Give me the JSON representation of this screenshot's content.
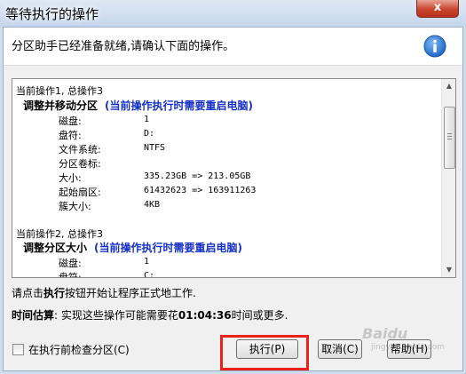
{
  "window": {
    "title": "等待执行的操作",
    "close_label": "x"
  },
  "header": {
    "message": "分区助手已经准备就绪,请确认下面的操作。",
    "icon": "info-icon"
  },
  "operations": [
    {
      "header": "当前操作1, 总操作3",
      "title": "调整并移动分区",
      "note": "(当前操作执行时需要重启电脑)",
      "properties": [
        {
          "label": "磁盘:",
          "value": "1"
        },
        {
          "label": "盘符:",
          "value": "D:"
        },
        {
          "label": "文件系统:",
          "value": "NTFS"
        },
        {
          "label": "分区卷标:",
          "value": ""
        },
        {
          "label": "大小:",
          "value": "335.23GB => 213.05GB"
        },
        {
          "label": "起始扇区:",
          "value": "61432623 => 163911263"
        },
        {
          "label": "簇大小:",
          "value": "4KB"
        }
      ]
    },
    {
      "header": "当前操作2, 总操作3",
      "title": "调整分区大小",
      "note": "(当前操作执行时需要重启电脑)",
      "properties": [
        {
          "label": "磁盘:",
          "value": "1"
        },
        {
          "label": "盘符:",
          "value": "C:"
        }
      ]
    }
  ],
  "hint": {
    "prefix": "请点击",
    "bold": "执行",
    "suffix": "按钮开始让程序正式地工作."
  },
  "estimate": {
    "label": "时间估算",
    "text_before": ": 实现这些操作可能需要花",
    "time": "01:04:36",
    "text_after": "时间或更多."
  },
  "checkbox": {
    "label": "在执行前检查分区(C)",
    "checked": false
  },
  "buttons": {
    "execute": "执行(P)",
    "cancel": "取消(C)",
    "help": "帮助(H)"
  },
  "watermark": {
    "text": "Baidu",
    "sub": "jingyan.baidu.com"
  },
  "colors": {
    "note_blue": "#1530c8",
    "highlight_red": "#e8231b",
    "close_red": "#c9452f"
  }
}
